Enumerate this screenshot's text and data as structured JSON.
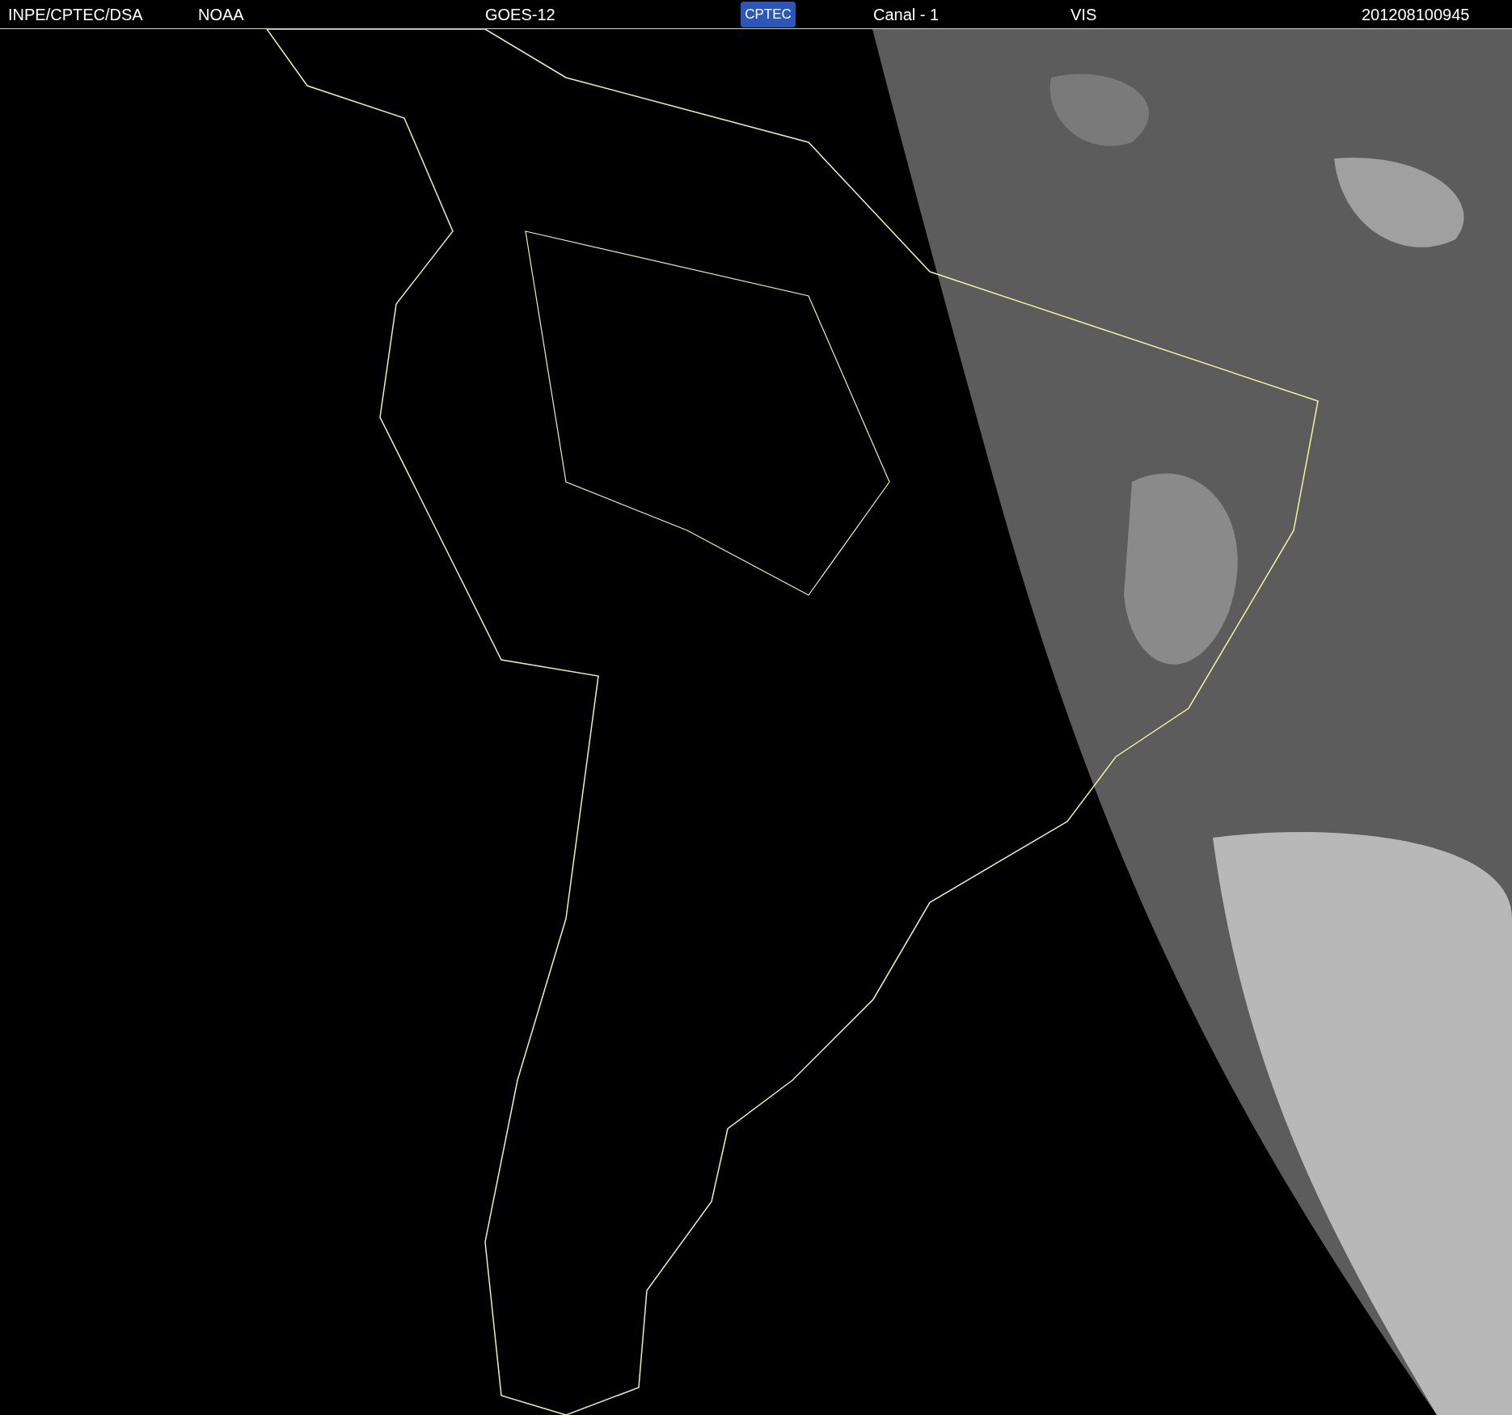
{
  "header": {
    "source": "INPE/CPTEC/DSA",
    "agency": "NOAA",
    "satellite": "GOES-12",
    "logo": "CPTEC",
    "channel": "Canal - 1",
    "band": "VIS",
    "timestamp": "201208100945"
  }
}
